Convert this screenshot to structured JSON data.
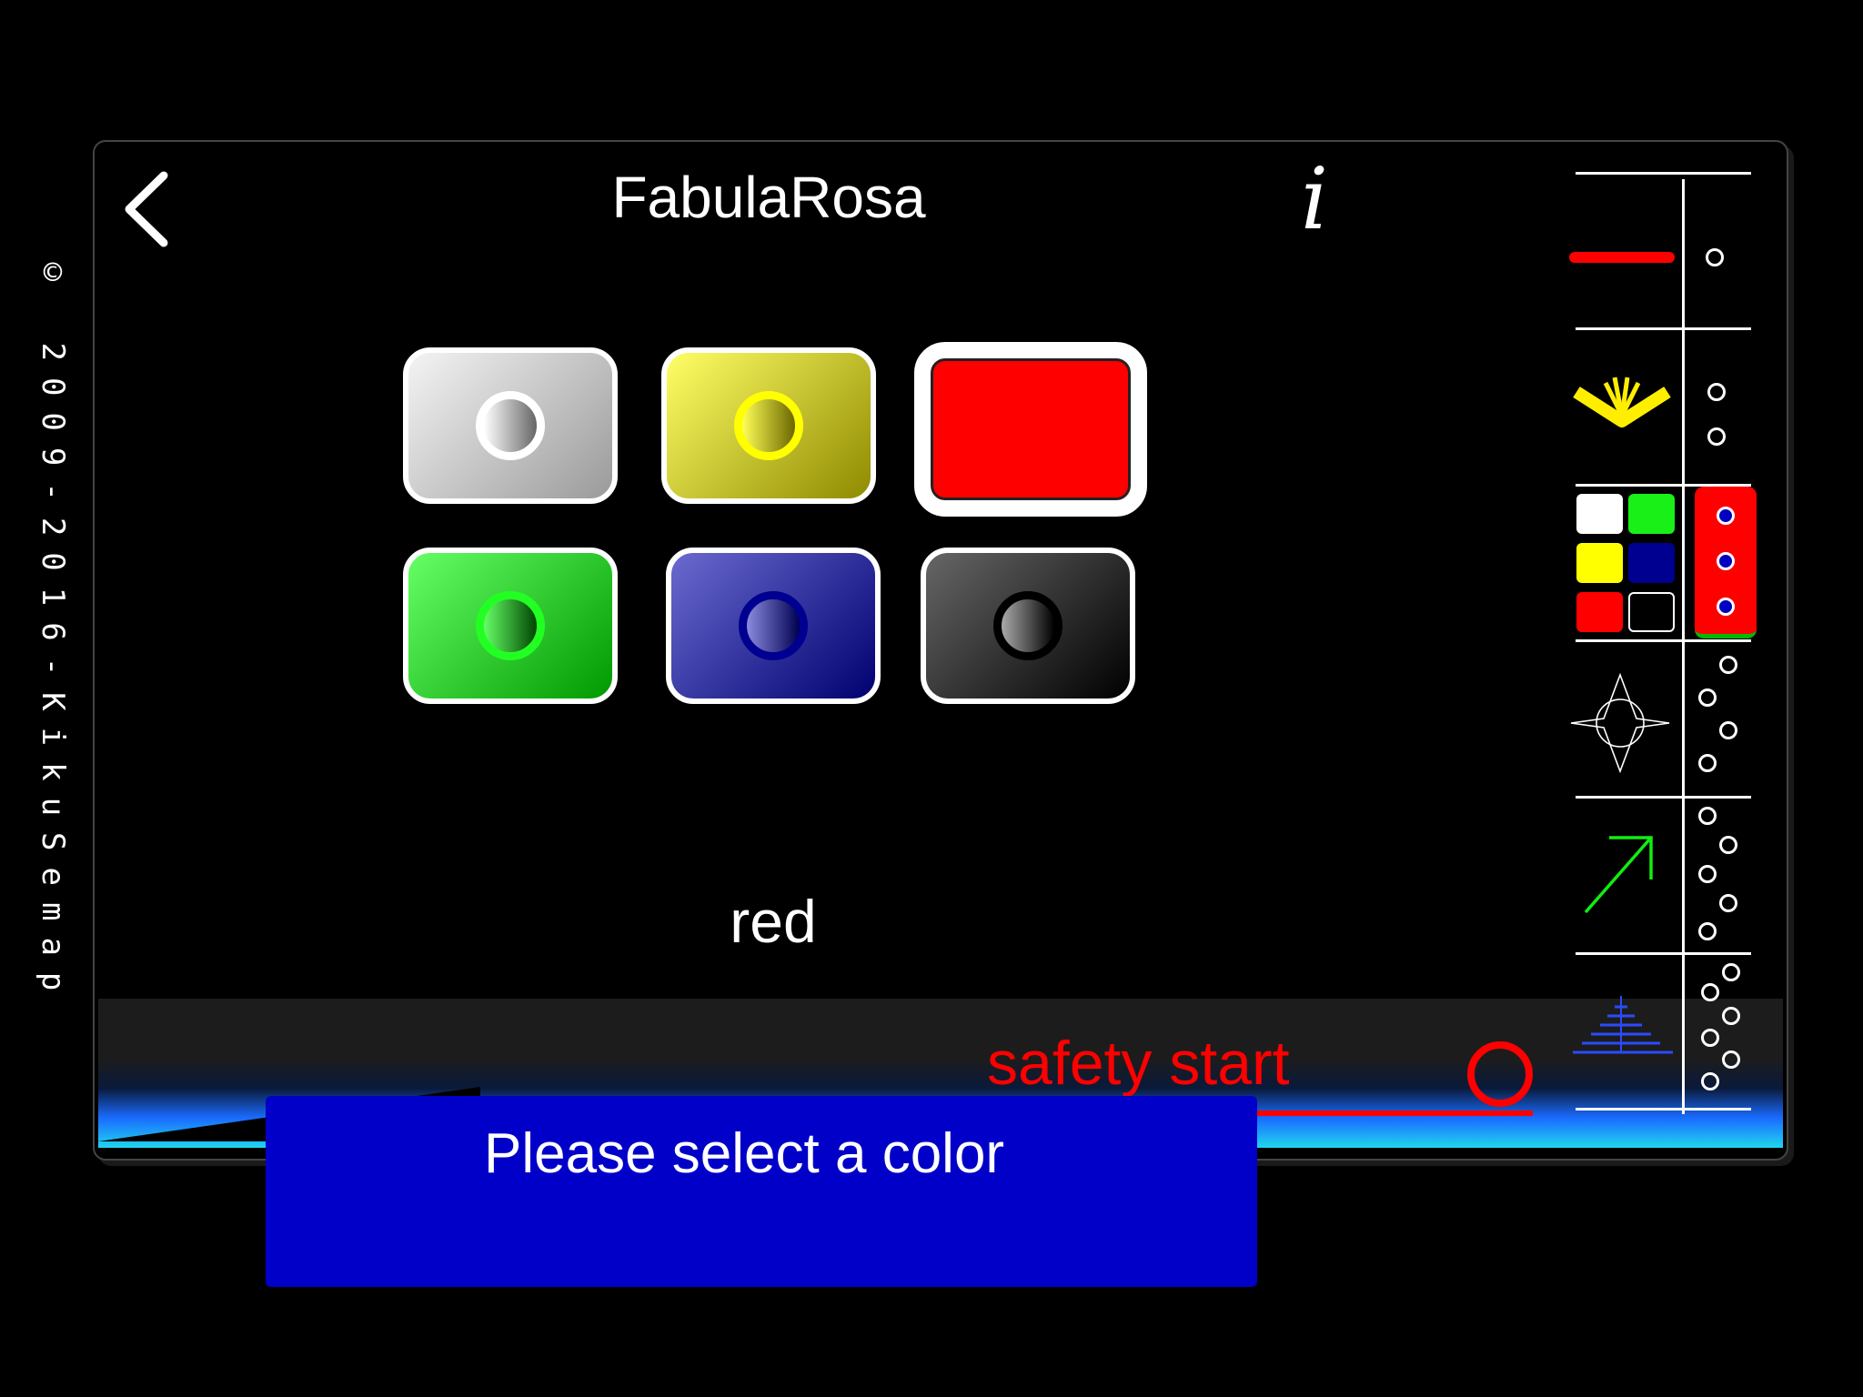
{
  "copyright": "© 2009-2016-KikuSemap",
  "header": {
    "title": "FabulaRosa",
    "info_glyph": "i"
  },
  "icons": {
    "back": "chevron-left-icon",
    "info": "info-icon"
  },
  "colors": {
    "palette": [
      {
        "name": "white",
        "fill": "#c8c8c8",
        "ring": "#ffffff"
      },
      {
        "name": "yellow",
        "fill": "#c9c222",
        "ring": "#ffff00"
      },
      {
        "name": "red",
        "fill": "#ff0000",
        "ring": "#ff0000",
        "selected": true
      },
      {
        "name": "green",
        "fill": "#22bb22",
        "ring": "#22ff22"
      },
      {
        "name": "blue",
        "fill": "#15157a",
        "ring": "#0000a0"
      },
      {
        "name": "black",
        "fill": "#2a2a2a",
        "ring": "#000000"
      }
    ],
    "accent_red": "#ff0000",
    "toast_blue": "#0000c8"
  },
  "selection": {
    "label": "red"
  },
  "safety": {
    "label": "safety start"
  },
  "toast": {
    "message": "Please select a color"
  },
  "rail": {
    "items": [
      {
        "name": "line-tool",
        "icon": "red-line-icon",
        "dots": 1
      },
      {
        "name": "rays-tool",
        "icon": "yellow-rays-icon",
        "dots": 2
      },
      {
        "name": "color-tool",
        "icon": "color-grid-icon",
        "dots": 3,
        "active": true
      },
      {
        "name": "star-tool",
        "icon": "compass-star-icon",
        "dots": 4
      },
      {
        "name": "arrow-tool",
        "icon": "green-arrow-icon",
        "dots": 5
      },
      {
        "name": "pyramid-tool",
        "icon": "blue-pyramid-icon",
        "dots": 6
      }
    ]
  }
}
